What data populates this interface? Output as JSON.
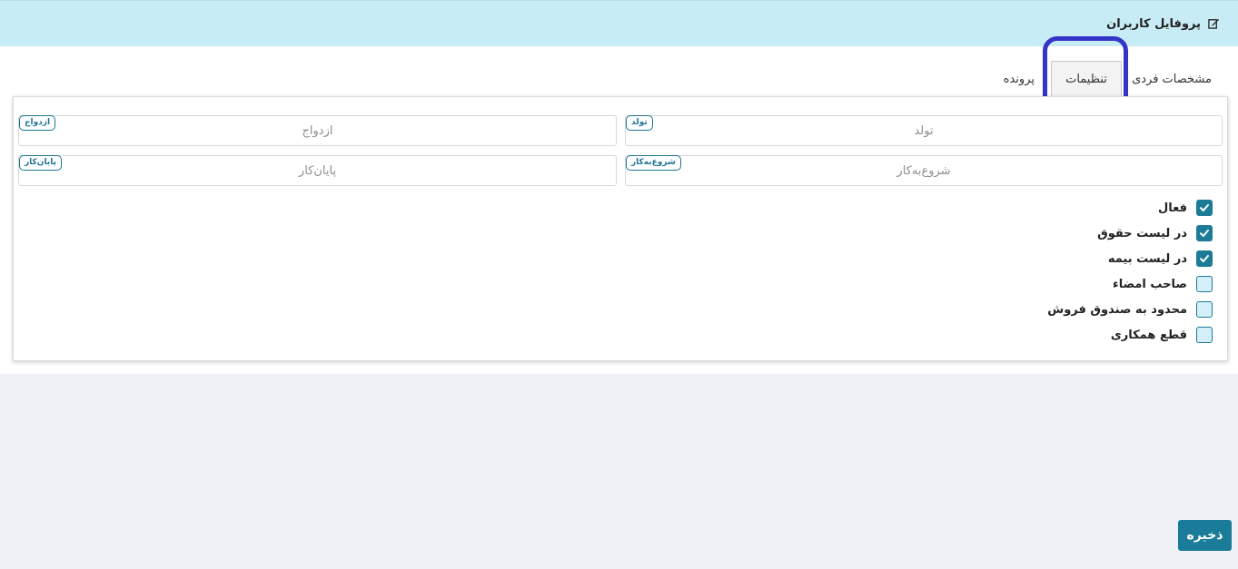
{
  "header": {
    "title": "پروفایل کاربران",
    "icon": "edit-icon"
  },
  "tabs": [
    {
      "label": "مشخصات فردی"
    },
    {
      "label": "تنظیمات",
      "active": true
    },
    {
      "label": "پرونده"
    }
  ],
  "fields": {
    "birth": {
      "badge": "تولد",
      "placeholder": "تولد"
    },
    "marriage": {
      "badge": "ازدواج",
      "placeholder": "ازدواج"
    },
    "work_start": {
      "badge": "شروع‌به‌کار",
      "placeholder": "شروع‌به‌کار"
    },
    "work_end": {
      "badge": "پایان‌کار",
      "placeholder": "پایان‌کار"
    }
  },
  "checkboxes": [
    {
      "label": "فعال",
      "checked": true
    },
    {
      "label": "در لیست حقوق",
      "checked": true
    },
    {
      "label": "در لیست بیمه",
      "checked": true
    },
    {
      "label": "صاحب امضاء",
      "checked": false
    },
    {
      "label": "محدود به صندوق فروش",
      "checked": false
    },
    {
      "label": "قطع همکاری",
      "checked": false
    }
  ],
  "save_label": "ذخیره",
  "colors": {
    "accent": "#1c7b96",
    "header_bg": "#c8ecf5",
    "highlight": "#3434c8"
  }
}
